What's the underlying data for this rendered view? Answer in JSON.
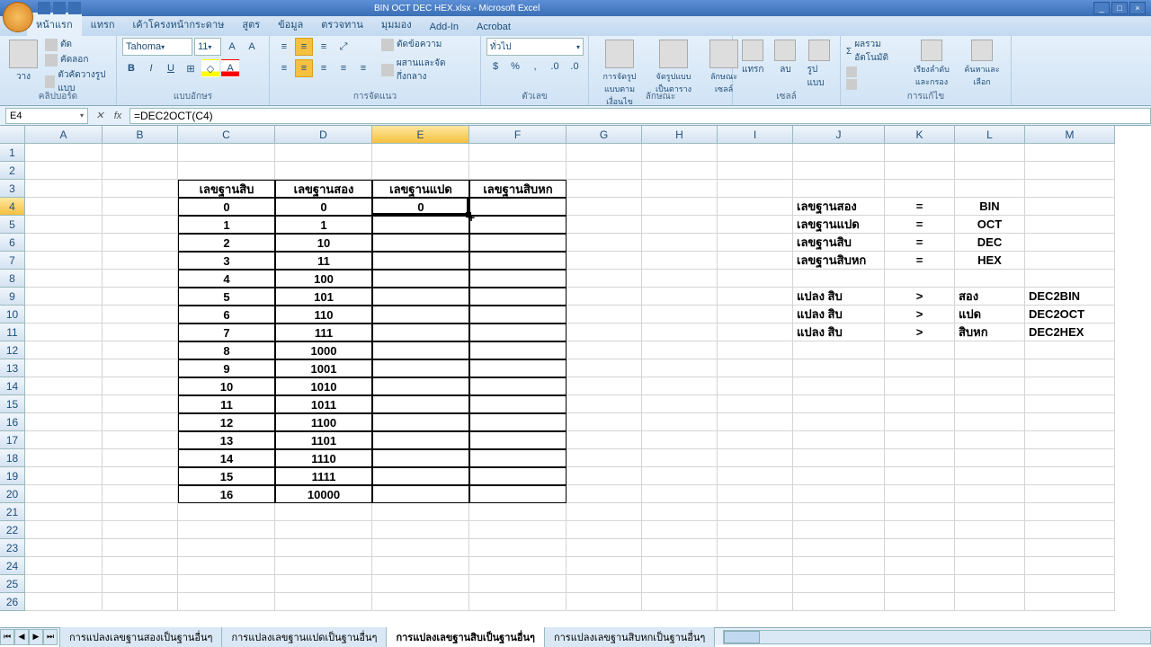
{
  "titlebar": {
    "title": "BIN OCT DEC HEX.xlsx - Microsoft Excel"
  },
  "qat": {
    "save": "save",
    "undo": "undo",
    "redo": "redo"
  },
  "tabs": [
    "หน้าแรก",
    "แทรก",
    "เค้าโครงหน้ากระดาษ",
    "สูตร",
    "ข้อมูล",
    "ตรวจทาน",
    "มุมมอง",
    "Add-In",
    "Acrobat"
  ],
  "ribbon": {
    "clipboard": {
      "label": "คลิปบอร์ด",
      "paste": "วาง",
      "cut": "ตัด",
      "copy": "คัดลอก",
      "format_painter": "ตัวคัดวางรูปแบบ"
    },
    "font": {
      "label": "แบบอักษร",
      "name": "Tahoma",
      "size": "11",
      "bold": "B",
      "italic": "I",
      "underline": "U"
    },
    "alignment": {
      "label": "การจัดแนว",
      "wrap": "ตัดข้อความ",
      "merge": "ผสานและจัดกึ่งกลาง"
    },
    "number": {
      "label": "ตัวเลข",
      "format": "ทั่วไป"
    },
    "styles": {
      "label": "ลักษณะ",
      "cond": "การจัดรูปแบบตามเงื่อนไข",
      "table": "จัดรูปแบบเป็นตาราง",
      "cell": "ลักษณะเซลล์"
    },
    "cells": {
      "label": "เซลล์",
      "insert": "แทรก",
      "delete": "ลบ",
      "format": "รูปแบบ"
    },
    "editing": {
      "label": "การแก้ไข",
      "autosum": "ผลรวมอัตโนมัติ",
      "sort": "เรียงลำดับและกรอง",
      "find": "ค้นหาและเลือก"
    }
  },
  "namebox": "E4",
  "formula": "=DEC2OCT(C4)",
  "columns": [
    "A",
    "B",
    "C",
    "D",
    "E",
    "F",
    "G",
    "H",
    "I",
    "J",
    "K",
    "L",
    "M"
  ],
  "selected_col": "E",
  "selected_row": 4,
  "table": {
    "headers": [
      "เลขฐานสิบ",
      "เลขฐานสอง",
      "เลขฐานแปด",
      "เลขฐานสิบหก"
    ],
    "rows": [
      [
        "0",
        "0",
        "0",
        ""
      ],
      [
        "1",
        "1",
        "",
        ""
      ],
      [
        "2",
        "10",
        "",
        ""
      ],
      [
        "3",
        "11",
        "",
        ""
      ],
      [
        "4",
        "100",
        "",
        ""
      ],
      [
        "5",
        "101",
        "",
        ""
      ],
      [
        "6",
        "110",
        "",
        ""
      ],
      [
        "7",
        "111",
        "",
        ""
      ],
      [
        "8",
        "1000",
        "",
        ""
      ],
      [
        "9",
        "1001",
        "",
        ""
      ],
      [
        "10",
        "1010",
        "",
        ""
      ],
      [
        "11",
        "1011",
        "",
        ""
      ],
      [
        "12",
        "1100",
        "",
        ""
      ],
      [
        "13",
        "1101",
        "",
        ""
      ],
      [
        "14",
        "1110",
        "",
        ""
      ],
      [
        "15",
        "1111",
        "",
        ""
      ],
      [
        "16",
        "10000",
        "",
        ""
      ]
    ]
  },
  "legend": {
    "bases": [
      {
        "th": "เลขฐานสอง",
        "eq": "=",
        "en": "BIN"
      },
      {
        "th": "เลขฐานแปด",
        "eq": "=",
        "en": "OCT"
      },
      {
        "th": "เลขฐานสิบ",
        "eq": "=",
        "en": "DEC"
      },
      {
        "th": "เลขฐานสิบหก",
        "eq": "=",
        "en": "HEX"
      }
    ],
    "convs": [
      {
        "a": "แปลง สิบ",
        "op": ">",
        "b": "สอง",
        "fn": "DEC2BIN"
      },
      {
        "a": "แปลง สิบ",
        "op": ">",
        "b": "แปด",
        "fn": "DEC2OCT"
      },
      {
        "a": "แปลง สิบ",
        "op": ">",
        "b": "สิบหก",
        "fn": "DEC2HEX"
      }
    ]
  },
  "sheets": [
    "การแปลงเลขฐานสองเป็นฐานอื่นๆ",
    "การแปลงเลขฐานแปดเป็นฐานอื่นๆ",
    "การแปลงเลขฐานสิบเป็นฐานอื่นๆ",
    "การแปลงเลขฐานสิบหกเป็นฐานอื่นๆ"
  ],
  "active_sheet": 2
}
